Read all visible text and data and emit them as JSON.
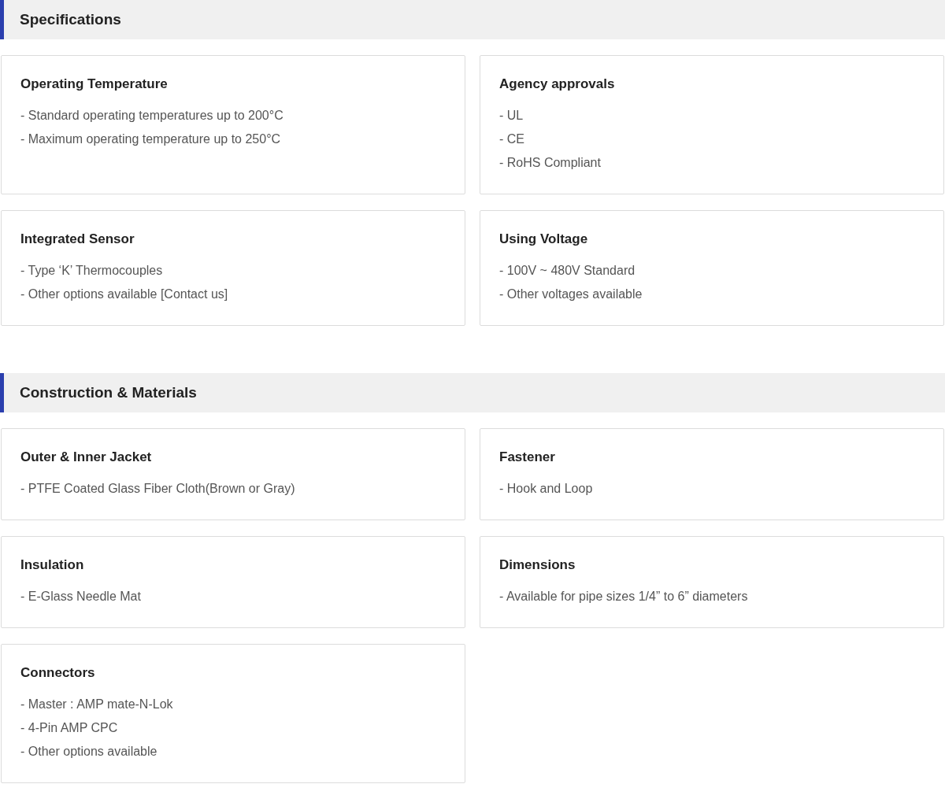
{
  "sections": [
    {
      "title": "Specifications",
      "cards": [
        {
          "title": "Operating Temperature",
          "items": [
            "- Standard operating temperatures up to 200°C",
            "- Maximum operating temperature up to 250°C"
          ]
        },
        {
          "title": "Agency approvals",
          "items": [
            "- UL",
            "- CE",
            "- RoHS Compliant"
          ]
        },
        {
          "title": "Integrated Sensor",
          "items": [
            "- Type ‘K’ Thermocouples",
            "- Other options available [Contact us]"
          ]
        },
        {
          "title": "Using Voltage",
          "items": [
            "- 100V ~ 480V Standard",
            "- Other voltages available"
          ]
        }
      ]
    },
    {
      "title": "Construction & Materials",
      "cards": [
        {
          "title": "Outer & Inner Jacket",
          "items": [
            "- PTFE Coated Glass Fiber Cloth(Brown or Gray)"
          ]
        },
        {
          "title": "Fastener",
          "items": [
            "- Hook and Loop"
          ]
        },
        {
          "title": "Insulation",
          "items": [
            "- E-Glass Needle Mat"
          ]
        },
        {
          "title": "Dimensions",
          "items": [
            "- Available for pipe sizes 1/4” to 6” diameters"
          ]
        },
        {
          "title": "Connectors",
          "items": [
            "- Master : AMP mate-N-Lok",
            "- 4-Pin AMP CPC",
            "- Other options available"
          ]
        }
      ]
    }
  ]
}
